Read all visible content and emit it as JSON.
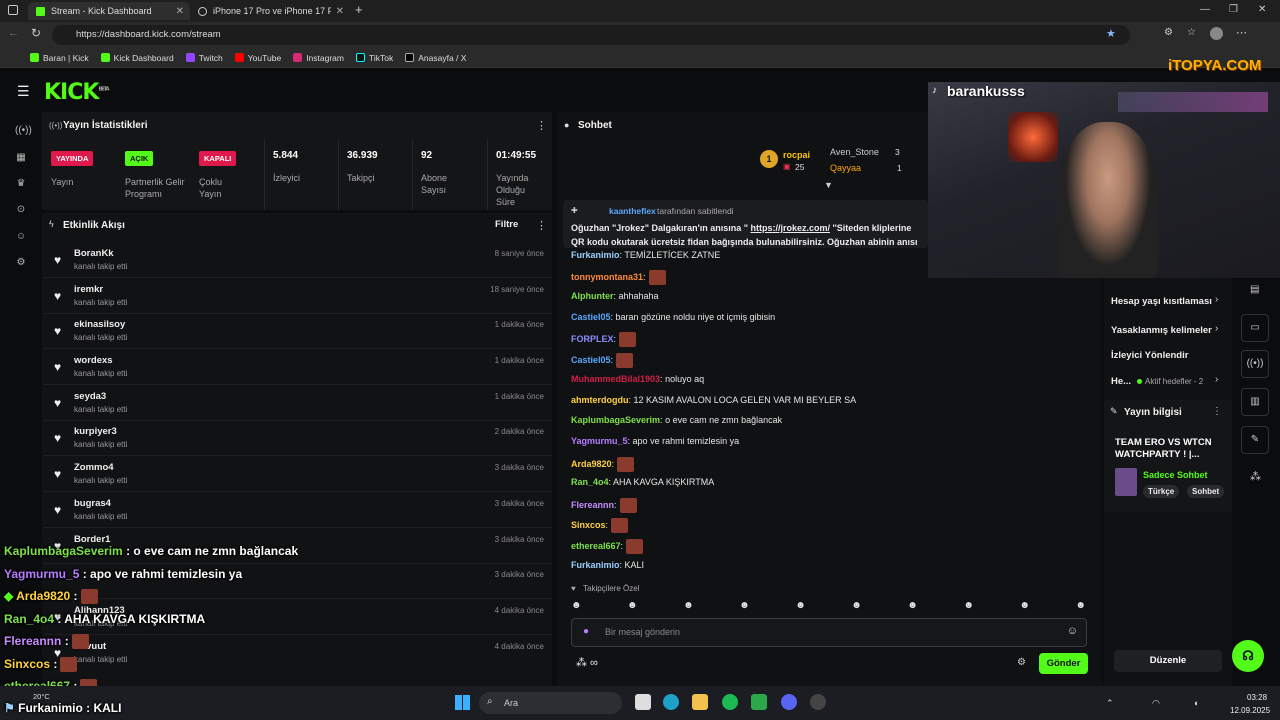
{
  "browser": {
    "tabs": [
      {
        "title": "Stream - Kick Dashboard"
      },
      {
        "title": "iPhone 17 Pro ve iPhone 17 Pro M"
      }
    ],
    "url": "https://dashboard.kick.com/stream",
    "bookmarks": [
      "Baran | Kick",
      "Kick Dashboard",
      "Twitch",
      "YouTube",
      "Instagram",
      "TikTok",
      "Anasayfa / X"
    ]
  },
  "brand": {
    "logo": "KICK",
    "logo_sup": "BETA",
    "accent": "#53fc18"
  },
  "stats_panel": {
    "title": "Yayın İstatistikleri",
    "items": [
      {
        "badge": "YAYINDA",
        "label": "Yayın",
        "color": "#e0194d"
      },
      {
        "badge": "AÇIK",
        "label": "Partnerlik Gelir Programı",
        "color": "#53fc18"
      },
      {
        "badge": "KAPALI",
        "label": "Çoklu Yayın",
        "color": "#e0194d"
      },
      {
        "value": "5.844",
        "label": "İzleyici"
      },
      {
        "value": "36.939",
        "label": "Takipçi"
      },
      {
        "value": "92",
        "label": "Abone Sayısı"
      },
      {
        "value": "01:49:55",
        "label": "Yayında Olduğu Süre"
      }
    ]
  },
  "activity": {
    "title": "Etkinlik Akışı",
    "filter": "Filtre",
    "rows": [
      {
        "name": "BoranKk",
        "sub": "kanalı takip etti",
        "time": "8 saniye önce"
      },
      {
        "name": "iremkr",
        "sub": "kanalı takip etti",
        "time": "18 saniye önce"
      },
      {
        "name": "ekinasilsoy",
        "sub": "kanalı takip etti",
        "time": "1 dakika önce"
      },
      {
        "name": "wordexs",
        "sub": "kanalı takip etti",
        "time": "1 dakika önce"
      },
      {
        "name": "seyda3",
        "sub": "kanalı takip etti",
        "time": "1 dakika önce"
      },
      {
        "name": "kurpiyer3",
        "sub": "kanalı takip etti",
        "time": "2 dakika önce"
      },
      {
        "name": "Zommo4",
        "sub": "kanalı takip etti",
        "time": "3 dakika önce"
      },
      {
        "name": "bugras4",
        "sub": "kanalı takip etti",
        "time": "3 dakika önce"
      },
      {
        "name": "Border1",
        "sub": "kanalı takip etti",
        "time": "3 dakika önce"
      },
      {
        "name": "",
        "sub": "kanalı takip etti",
        "time": "3 dakika önce"
      },
      {
        "name": "Alihann123",
        "sub": "kanalı takip etti",
        "time": "4 dakika önce"
      },
      {
        "name": "Davuut",
        "sub": "kanalı takip etti",
        "time": "4 dakika önce"
      }
    ]
  },
  "chat": {
    "title": "Sohbet",
    "leaderboard": [
      {
        "name": "rocpai",
        "count": "25"
      },
      {
        "name": "Aven_Stone",
        "count": "3"
      },
      {
        "name": "Qayyaa",
        "count": "1"
      }
    ],
    "pinned": {
      "by": "kaantheflex",
      "by_suffix": "tarafından sabitlendi",
      "text1": "Oğuzhan \"Jrokez\" Dalgakıran'ın anısına \" ",
      "link": "https://jrokez.com/",
      "text2": " ''Siteden kliplerine",
      "text3": "QR kodu okutarak ücretsiz fidan bağışında bulunabilirsiniz. Oğuzhan abinin anısı"
    },
    "messages": [
      {
        "user": "Furkanimio",
        "text": "TEMİZLETİCEK ZATNE",
        "color": "#9ad0ff"
      },
      {
        "user": "tonnymontana31",
        "text": "",
        "color": "#ff8a3d",
        "emote": true
      },
      {
        "user": "Alphunter",
        "text": "ahhahaha",
        "color": "#7ee04a"
      },
      {
        "user": "Castiel05",
        "text": "baran gözüne noldu niye ot içmiş gibisin",
        "color": "#5aa7ff"
      },
      {
        "user": "FORPLEX",
        "text": "",
        "color": "#8b8bff",
        "emote": true
      },
      {
        "user": "Castiel05",
        "text": "",
        "color": "#5aa7ff",
        "emote": true
      },
      {
        "user": "MuhammedBilal1903",
        "text": "noluyo aq",
        "color": "#d11f4a"
      },
      {
        "user": "ahmterdogdu",
        "text": "12 KASIM AVALON LOCA GELEN VAR MI BEYLER SA",
        "color": "#ffd23f"
      },
      {
        "user": "KaplumbagaSeverim",
        "text": "o eve cam ne zmn bağlancak",
        "color": "#7ee04a"
      },
      {
        "user": "Yagmurmu_5",
        "text": "apo ve rahmi temizlesin ya",
        "color": "#b77cff"
      },
      {
        "user": "Arda9820",
        "text": "",
        "color": "#ffd23f",
        "emote": true
      },
      {
        "user": "Ran_4o4",
        "text": "AHA KAVGA KIŞKIRTMA",
        "color": "#7ee04a"
      },
      {
        "user": "Flereannn",
        "text": "",
        "color": "#c58cff",
        "emote": true
      },
      {
        "user": "Sinxcos",
        "text": "",
        "color": "#ffd23f",
        "emote": true
      },
      {
        "user": "ethereal667",
        "text": "",
        "color": "#7ee04a",
        "emote": true
      },
      {
        "user": "Furkanimio",
        "text": "KALI",
        "color": "#9ad0ff"
      }
    ],
    "followers_only": "Takipçilere Özel",
    "input_placeholder": "Bir mesaj gönderin",
    "send": "Gönder"
  },
  "webcam": {
    "name": "barankusss",
    "watermark": "iTOPYA.COM"
  },
  "right_panel": {
    "items": [
      "Hesap yaşı kısıtlaması",
      "Yasaklanmış kelimeler",
      "İzleyici Yönlendir"
    ],
    "he": "He...",
    "goals": "Aktif hedefler - 2",
    "info_title": "Yayın bilgisi",
    "stream_title": "TEAM ERO VS WTCN WATCHPARTY ! |...",
    "category": "Sadece Sohbet",
    "tags": [
      "Türkçe",
      "Sohbet"
    ],
    "edit": "Düzenle"
  },
  "overlay_chat": [
    {
      "user": "KaplumbagaSeverim",
      "text": ": o eve cam ne zmn bağlancak",
      "color": "#7ee04a"
    },
    {
      "user": "Yagmurmu_5",
      "text": ": apo ve rahmi temizlesin ya",
      "color": "#b77cff"
    },
    {
      "user": "Arda9820",
      "text": ":",
      "color": "#ffd23f"
    },
    {
      "user": "Ran_4o4",
      "text": ": AHA KAVGA KIŞKIRTMA",
      "color": "#7ee04a"
    },
    {
      "user": "Flereannn",
      "text": ":",
      "color": "#c58cff"
    },
    {
      "user": "Sinxcos",
      "text": ":",
      "color": "#ffd23f"
    },
    {
      "user": "ethereal667",
      "text": ":",
      "color": "#7ee04a"
    },
    {
      "user": "Furkanimio",
      "text": ": KALI",
      "color": "#9ad0ff"
    }
  ],
  "taskbar": {
    "search": "Ara",
    "time": "03:28",
    "date": "12.09.2025",
    "temp": "20°C"
  }
}
